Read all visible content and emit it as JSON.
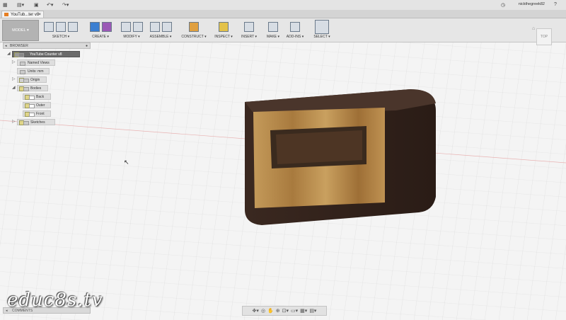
{
  "app": {
    "doc_tab": "YouTub...ter v8",
    "user": "nickthegreek82",
    "help": "?"
  },
  "ribbon": {
    "model_label": "MODEL",
    "groups": [
      {
        "label": "SKETCH"
      },
      {
        "label": "CREATE"
      },
      {
        "label": "MODIFY"
      },
      {
        "label": "ASSEMBLE"
      },
      {
        "label": "CONSTRUCT"
      },
      {
        "label": "INSPECT"
      },
      {
        "label": "INSERT"
      },
      {
        "label": "MAKE"
      },
      {
        "label": "ADD-INS"
      },
      {
        "label": "SELECT"
      }
    ]
  },
  "browser": {
    "title": "BROWSER",
    "root": "YouTube Counter v8",
    "items": [
      {
        "label": "Named Views"
      },
      {
        "label": "Units: mm"
      },
      {
        "label": "Origin"
      },
      {
        "label": "Bodies"
      },
      {
        "label": "Back"
      },
      {
        "label": "Outer"
      },
      {
        "label": "Front"
      },
      {
        "label": "Sketches"
      }
    ]
  },
  "viewcube": {
    "face": "TOP"
  },
  "comments": {
    "label": "COMMENTS"
  },
  "watermark": "educ8s.tv",
  "colors": {
    "wood_frame": "#3b2a22",
    "wood_panel": "#b98a4c",
    "select_blue": "#2c7fd0"
  }
}
